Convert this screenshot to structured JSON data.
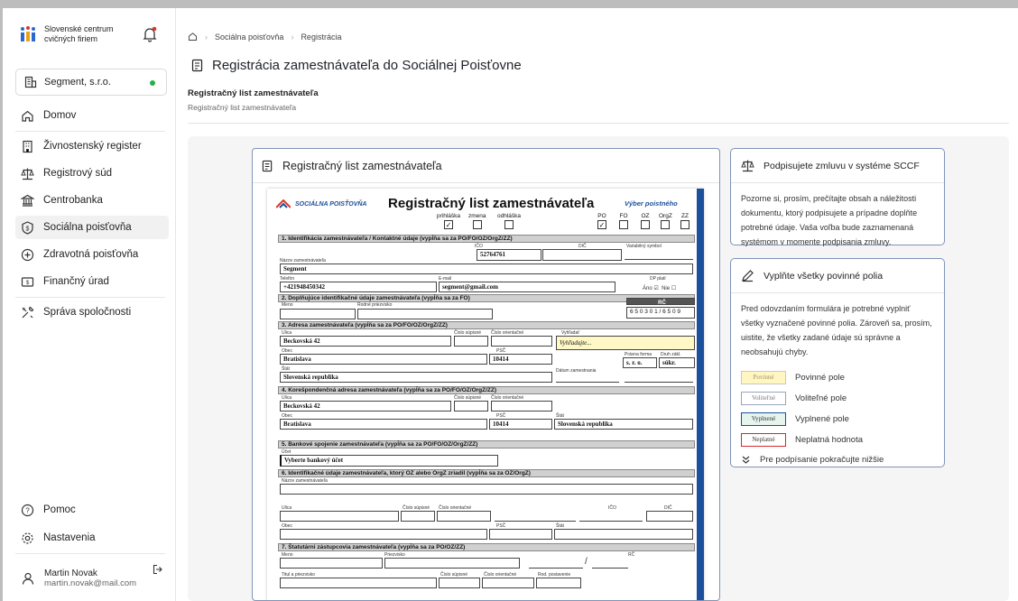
{
  "sidebar": {
    "brand": {
      "line1": "Slovenské centrum",
      "line2": "cvičných firiem"
    },
    "company": "Segment, s.r.o.",
    "items": [
      {
        "label": "Domov",
        "icon": "home-icon"
      },
      {
        "label": "Živnostenský register",
        "icon": "building-icon"
      },
      {
        "label": "Registrový súd",
        "icon": "scales-icon"
      },
      {
        "label": "Centrobanka",
        "icon": "bank-icon"
      },
      {
        "label": "Sociálna poisťovňa",
        "icon": "dollar-badge-icon"
      },
      {
        "label": "Zdravotná poisťovňa",
        "icon": "health-icon"
      },
      {
        "label": "Finančný úrad",
        "icon": "finance-icon"
      },
      {
        "label": "Správa spoločnosti",
        "icon": "tools-icon"
      }
    ],
    "help": "Pomoc",
    "settings": "Nastavenia",
    "user": {
      "name": "Martin Novak",
      "email": "martin.novak@mail.com"
    }
  },
  "breadcrumb": {
    "current_parent": "Sociálna poisťovňa",
    "current": "Registrácia"
  },
  "page": {
    "title": "Registrácia zamestnávateľa do Sociálnej Poisťovne",
    "section_title": "Registračný list zamestnávateľa",
    "section_subtitle": "Registračný list zamestnávateľa"
  },
  "form_card": {
    "title": "Registračný list zamestnávateľa",
    "doc": {
      "logo": "SOCIÁLNA POISŤOVŇA",
      "title": "Registračný list zamestnávateľa",
      "choose": "Výber poistného",
      "checks_left": [
        {
          "label": "prihláška",
          "checked": "✓"
        },
        {
          "label": "zmena",
          "checked": ""
        },
        {
          "label": "odhláška",
          "checked": ""
        }
      ],
      "checks_right": [
        {
          "label": "PO",
          "checked": "✓"
        },
        {
          "label": "FO",
          "checked": ""
        },
        {
          "label": "OZ",
          "checked": ""
        },
        {
          "label": "OrgZ",
          "checked": ""
        },
        {
          "label": "ZZ",
          "checked": ""
        }
      ],
      "sections": [
        "1. Identifikácia zamestnávateľa / Kontaktné údaje (vypĺňa sa za PO/FO/OZ/OrgZ/ZZ)",
        "2. Doplňujúce identifikačné údaje zamestnávateľa (vypĺňa sa za FO)",
        "3. Adresa zamestnávateľa (vypĺňa sa za PO/FO/OZ/OrgZ/ZZ)",
        "4. Korešpondenčná adresa zamestnávateľa (vypĺňa sa za PO/FO/OZ/OrgZ/ZZ)",
        "5. Bankové spojenie zamestnávateľa (vypĺňa sa za PO/FO/OZ/OrgZ/ZZ)",
        "6. Identifikačné údaje zamestnávateľa, ktorý OZ alebo OrgZ zriadil (vypĺňa sa za OZ/OrgZ)",
        "7. Štatutárni zástupcovia zamestnávateľa (vypĺňa sa za PO/OZ/ZZ)"
      ],
      "labels": {
        "ico": "IČO",
        "dic": "DIČ",
        "varsym": "Variabilný symbol",
        "name": "Názov zamestnávateľa",
        "phone": "Telefón",
        "email": "E-mail",
        "dp": "DP platí",
        "yes": "Áno",
        "no": "Nie",
        "rc": "RČ",
        "surname": "Meno",
        "birth": "Rodné priezvisko",
        "street": "Ulica",
        "sup": "Číslo súpisné",
        "orient": "Číslo orientačné",
        "search": "Vyhľadať",
        "city": "Obec",
        "psc": "PSČ",
        "legal": "Právna forma",
        "status": "Druh zákl.",
        "state": "Štát",
        "valid": "Dátum zamestnania",
        "account": "Účet",
        "org_name": "Názov zamestnávateľa",
        "name7": "Meno",
        "surname7": "Priezvisko",
        "title7": "Titul a priezvisko",
        "pos": "Rod. postavenie"
      },
      "values": {
        "ico": "52764761",
        "name": "Segment",
        "phone": "+421948450342",
        "email": "segment@gmail.com",
        "rc": "6 5 0 3 0 1 / 6 5 0 9",
        "street": "Beckovská 42",
        "search_placeholder": "Vyhľadajte...",
        "city": "Bratislava",
        "psc": "10414",
        "legal": "s. r. o.",
        "status": "súkr.",
        "state": "Slovenská republika",
        "c_street": "Beckovská 42",
        "c_city": "Bratislava",
        "c_psc": "10414",
        "c_state": "Slovenská republika",
        "account": "Vyberte bankový účet"
      }
    }
  },
  "panel1": {
    "title": "Podpisujete zmluvu v systéme SCCF",
    "body": "Pozorne si, prosím, prečítajte obsah a náležitosti dokumentu, ktorý podpisujete a prípadne doplňte potrebné údaje. Vaša voľba bude zaznamenaná systémom v momente podpisania zmluvy."
  },
  "panel2": {
    "title": "Vyplňte všetky povinné polia",
    "body": "Pred odovzdaním formulára je potrebné vyplniť všetky vyznačené povinné polia. Zároveň sa, prosím, uistite, že všetky zadané údaje sú správne a neobsahujú chyby.",
    "legend": [
      {
        "badge": "Povinné",
        "label": "Povinné pole",
        "color": "#fff6c2",
        "border": "#c9c9c9",
        "text": "#a09060"
      },
      {
        "badge": "Voliteľné",
        "label": "Voliteľné pole",
        "color": "#ffffff",
        "border": "#9aa4c0",
        "text": "#777"
      },
      {
        "badge": "Vyplnené",
        "label": "Vyplnené pole",
        "color": "#e6f4ee",
        "border": "#1c4f9c",
        "text": "#333"
      },
      {
        "badge": "Neplatné",
        "label": "Neplatná hodnota",
        "color": "#ffffff",
        "border": "#d42b2b",
        "text": "#333"
      }
    ],
    "note": "Pre podpísanie pokračujte nižšie"
  }
}
